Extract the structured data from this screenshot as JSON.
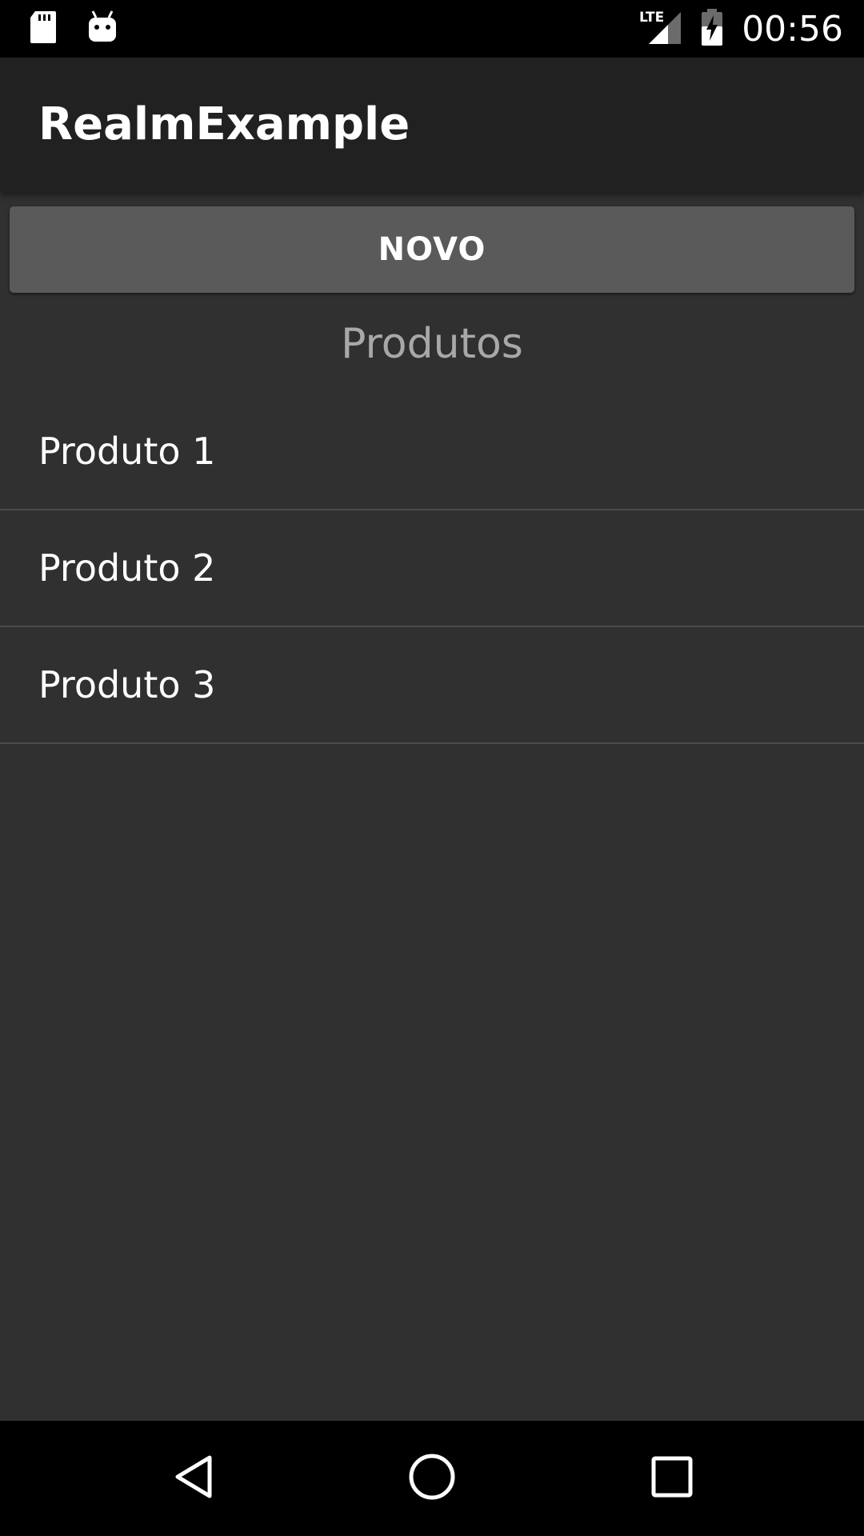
{
  "status_bar": {
    "left_icons": [
      "sd-card-icon",
      "android-debug-icon"
    ],
    "right_icons": [
      "lte-signal-icon",
      "battery-charging-icon"
    ],
    "network_label": "LTE",
    "time": "00:56"
  },
  "app_bar": {
    "title": "RealmExample"
  },
  "main": {
    "new_button_label": "NOVO",
    "section_title": "Produtos",
    "products": [
      {
        "name": "Produto 1"
      },
      {
        "name": "Produto 2"
      },
      {
        "name": "Produto 3"
      }
    ]
  },
  "nav_bar": {
    "buttons": [
      "back-icon",
      "home-icon",
      "recents-icon"
    ]
  },
  "colors": {
    "status_bar": "#000000",
    "app_bar": "#212121",
    "background": "#303030",
    "button": "#5a5a5a",
    "divider": "#4c4c4c",
    "section_title": "#a8a8a8"
  }
}
